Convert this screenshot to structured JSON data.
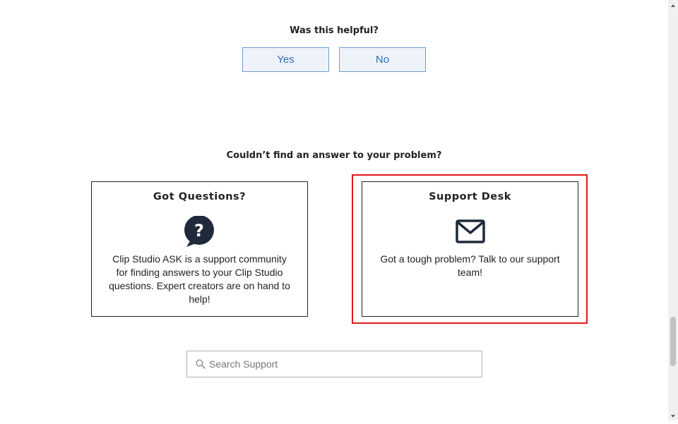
{
  "feedback": {
    "title": "Was this helpful?",
    "yes_label": "Yes",
    "no_label": "No"
  },
  "not_found": {
    "title": "Couldn’t find an answer to your problem?"
  },
  "cards": [
    {
      "title": "Got Questions?",
      "icon": "question-bubble-icon",
      "description": "Clip Studio ASK is a support community for finding answers to your Clip Studio questions. Expert creators are on hand to help!"
    },
    {
      "title": "Support Desk",
      "icon": "mail-icon",
      "description": "Got a tough problem? Talk to our support team!",
      "highlighted": true
    }
  ],
  "search": {
    "placeholder": "Search Support",
    "value": ""
  },
  "colors": {
    "button_border": "#6f9cd1",
    "button_text": "#2f6fbf",
    "button_bg": "#eef3f9",
    "highlight": "#e01a1a",
    "icon_dark": "#1f2a3a"
  }
}
